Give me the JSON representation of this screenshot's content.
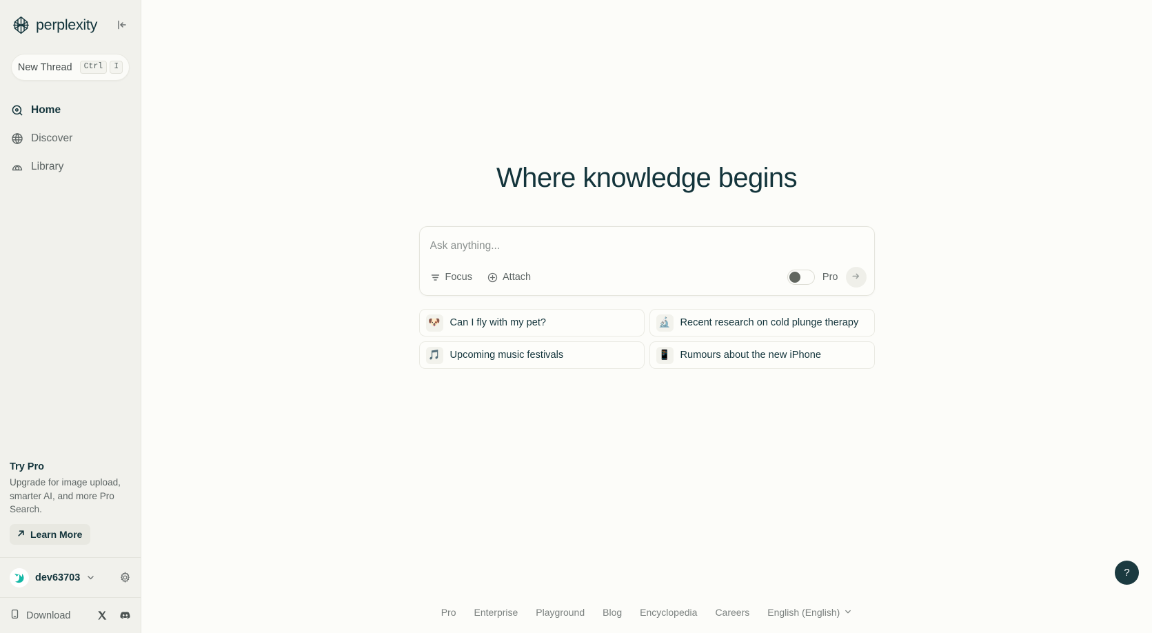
{
  "brand": {
    "name": "perplexity",
    "logo_icon": "perplexity-logo",
    "collapse_icon": "collapse-sidebar-icon"
  },
  "sidebar": {
    "new_thread": {
      "label": "New Thread",
      "shortcut_modifier": "Ctrl",
      "shortcut_key": "I"
    },
    "nav_items": [
      {
        "label": "Home",
        "icon": "home-target-icon",
        "active": true
      },
      {
        "label": "Discover",
        "icon": "globe-icon",
        "active": false
      },
      {
        "label": "Library",
        "icon": "library-icon",
        "active": false
      }
    ],
    "try_pro": {
      "title": "Try Pro",
      "description": "Upgrade for image upload, smarter AI, and more Pro Search.",
      "cta_label": "Learn More",
      "cta_icon": "arrow-up-right-icon"
    },
    "account": {
      "username": "dev63703",
      "avatar_icon": "user-avatar",
      "caret_icon": "chevron-down-icon",
      "settings_icon": "gear-icon"
    },
    "bottom": {
      "download_label": "Download",
      "download_icon": "mobile-device-icon",
      "twitter_icon": "x-twitter-icon",
      "discord_icon": "discord-icon"
    }
  },
  "main": {
    "hero_title": "Where knowledge begins",
    "composer": {
      "placeholder": "Ask anything...",
      "value": "",
      "focus_label": "Focus",
      "focus_icon": "filter-sliders-icon",
      "attach_label": "Attach",
      "attach_icon": "plus-circle-icon",
      "pro_label": "Pro",
      "pro_enabled": false,
      "submit_icon": "arrow-right-icon"
    },
    "suggestions": [
      {
        "emoji": "🐶",
        "emoji_name": "dog-face-emoji",
        "text": "Can I fly with my pet?"
      },
      {
        "emoji": "🔬",
        "emoji_name": "microscope-emoji",
        "text": "Recent research on cold plunge therapy"
      },
      {
        "emoji": "🎵",
        "emoji_name": "music-note-emoji",
        "text": "Upcoming music festivals"
      },
      {
        "emoji": "📱",
        "emoji_name": "mobile-phone-emoji",
        "text": "Rumours about the new iPhone"
      }
    ]
  },
  "footer": {
    "links": [
      "Pro",
      "Enterprise",
      "Playground",
      "Blog",
      "Encyclopedia",
      "Careers"
    ],
    "language": "English (English)",
    "language_caret_icon": "chevron-down-icon",
    "help_label": "?"
  },
  "colors": {
    "page_bg": "#fcfcf9",
    "sidebar_bg": "#f1f1ec",
    "accent_teal": "#20808d",
    "text_primary": "#13343b",
    "text_muted": "#5d6564",
    "help_bg": "#1b3a40"
  }
}
